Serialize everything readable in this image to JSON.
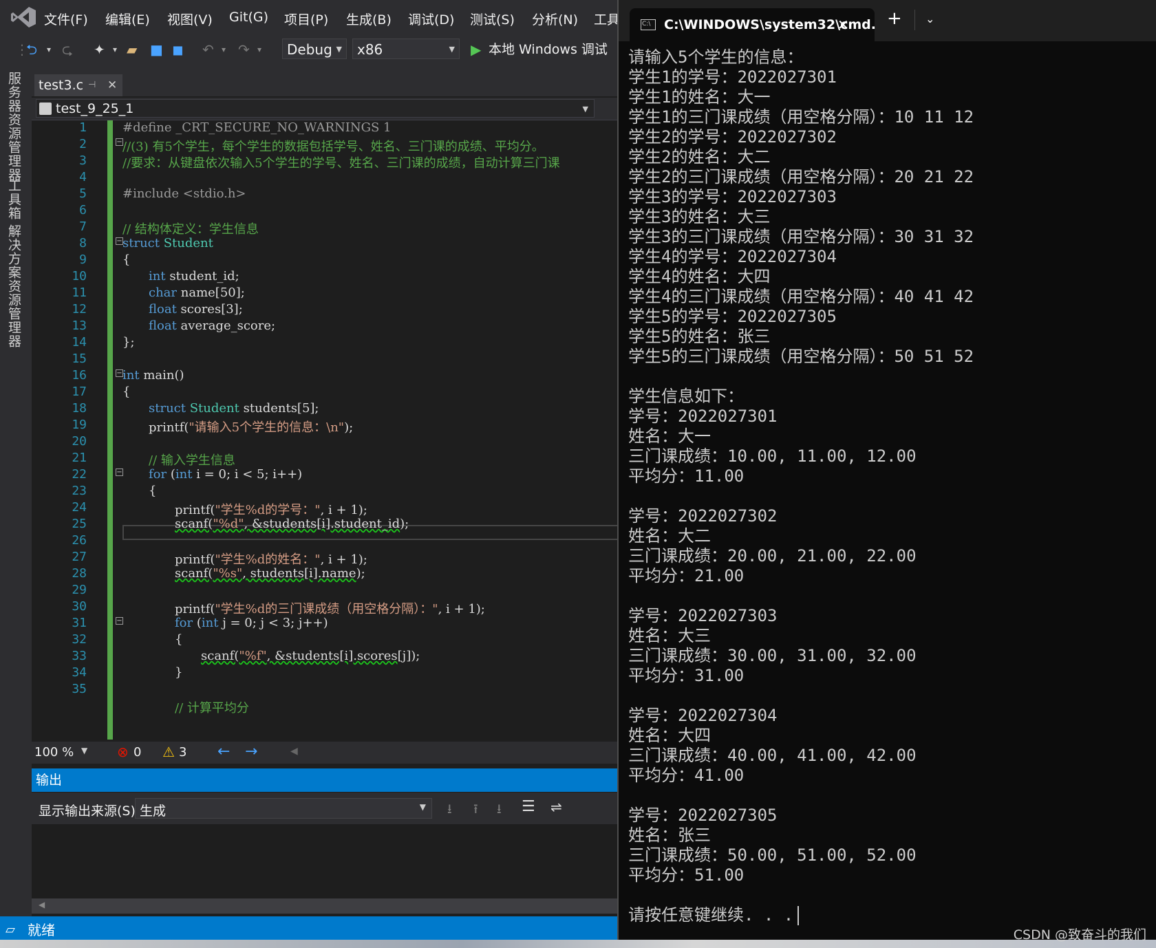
{
  "vs": {
    "menus": [
      "文件(F)",
      "编辑(E)",
      "视图(V)",
      "Git(G)",
      "项目(P)",
      "生成(B)",
      "调试(D)",
      "测试(S)",
      "分析(N)",
      "工具"
    ],
    "toolbar": {
      "config": "Debug",
      "platform": "x86",
      "run_label": "本地 Windows 调试"
    },
    "side_tabs": [
      "服务器资源管理器",
      "工具箱",
      "解决方案资源管理器"
    ],
    "doc_tab": {
      "label": "test3.c"
    },
    "nav_project": "test_9_25_1",
    "line_numbers": [
      "1",
      "2",
      "3",
      "4",
      "5",
      "6",
      "7",
      "8",
      "9",
      "10",
      "11",
      "12",
      "13",
      "14",
      "15",
      "16",
      "17",
      "18",
      "19",
      "20",
      "21",
      "22",
      "23",
      "24",
      "25",
      "26",
      "27",
      "28",
      "29",
      "30",
      "31",
      "32",
      "33",
      "34",
      "35"
    ],
    "code": {
      "l1": "#define _CRT_SECURE_NO_WARNINGS 1",
      "l2": "//(3) 有5个学生，每个学生的数据包括学号、姓名、三门课的成绩、平均分。",
      "l3": "//要求：从键盘依次输入5个学生的学号、姓名、三门课的成绩，自动计算三门课",
      "l5": "#include <stdio.h>",
      "l7": "// 结构体定义：学生信息",
      "l8_kw": "struct",
      "l8_ty": "Student",
      "l9": "{",
      "l10_kw": "int",
      "l10_rest": "student_id;",
      "l11_kw": "char",
      "l11_rest": "name[50];",
      "l12_kw": "float",
      "l12_rest": "scores[3];",
      "l13_kw": "float",
      "l13_rest": "average_score;",
      "l14": "};",
      "l16_kw": "int",
      "l16_rest": "main()",
      "l17": "{",
      "l18_kw": "struct",
      "l18_ty": "Student",
      "l18_rest": "students[5];",
      "l19_a": "printf(",
      "l19_str": "\"请输入5个学生的信息：\\n\"",
      "l19_b": ");",
      "l21": "// 输入学生信息",
      "l22_kw": "for",
      "l22_a": "(",
      "l22_kw2": "int",
      "l22_b": "i = 0; i < 5; i++)",
      "l23": "{",
      "l24_a": "printf(",
      "l24_str": "\"学生%d的学号：\"",
      "l24_b": ", i + 1);",
      "l25_a": "scanf(",
      "l25_str": "\"%d\"",
      "l25_b": ", &students[i].student_id",
      "l25_c": ");",
      "l27_a": "printf(",
      "l27_str": "\"学生%d的姓名：\"",
      "l27_b": ", i + 1);",
      "l28_a": "scanf(",
      "l28_str": "\"%s\"",
      "l28_b": ", students[i].name",
      "l28_c": ");",
      "l30_a": "printf(",
      "l30_str": "\"学生%d的三门课成绩（用空格分隔）：\"",
      "l30_b": ", i + 1);",
      "l31_kw": "for",
      "l31_a": "(",
      "l31_kw2": "int",
      "l31_b": "j = 0; j < 3; j++)",
      "l32": "{",
      "l33_a": "scanf(",
      "l33_str": "\"%f\"",
      "l33_b": ", &students[i].scores[j]",
      "l33_c": ");",
      "l34": "}",
      "l36": "// 计算平均分"
    },
    "status": {
      "zoom": "100 %",
      "errors": "0",
      "warnings": "3"
    },
    "output": {
      "title": "输出",
      "source_label": "显示输出来源(S):",
      "source_value": "生成"
    },
    "statusbar": {
      "text": "就绪"
    }
  },
  "terminal": {
    "tab_title": "C:\\WINDOWS\\system32\\cmd.",
    "lines": [
      "请输入5个学生的信息：",
      "学生1的学号：2022027301",
      "学生1的姓名：大一",
      "学生1的三门课成绩（用空格分隔）：10 11 12",
      "学生2的学号：2022027302",
      "学生2的姓名：大二",
      "学生2的三门课成绩（用空格分隔）：20 21 22",
      "学生3的学号：2022027303",
      "学生3的姓名：大三",
      "学生3的三门课成绩（用空格分隔）：30 31 32",
      "学生4的学号：2022027304",
      "学生4的姓名：大四",
      "学生4的三门课成绩（用空格分隔）：40 41 42",
      "学生5的学号：2022027305",
      "学生5的姓名：张三",
      "学生5的三门课成绩（用空格分隔）：50 51 52",
      "",
      "学生信息如下：",
      "学号：2022027301",
      "姓名：大一",
      "三门课成绩：10.00, 11.00, 12.00",
      "平均分：11.00",
      "",
      "学号：2022027302",
      "姓名：大二",
      "三门课成绩：20.00, 21.00, 22.00",
      "平均分：21.00",
      "",
      "学号：2022027303",
      "姓名：大三",
      "三门课成绩：30.00, 31.00, 32.00",
      "平均分：31.00",
      "",
      "学号：2022027304",
      "姓名：大四",
      "三门课成绩：40.00, 41.00, 42.00",
      "平均分：41.00",
      "",
      "学号：2022027305",
      "姓名：张三",
      "三门课成绩：50.00, 51.00, 52.00",
      "平均分：51.00",
      "",
      "请按任意键继续. . ."
    ]
  },
  "watermark": "CSDN @致奋斗的我们",
  "colors": {
    "accent": "#007acc",
    "editor_bg": "#1e1e1e",
    "terminal_bg": "#0c0c0c",
    "keyword": "#569cd6",
    "comment": "#57a64a",
    "string": "#d69d85"
  }
}
